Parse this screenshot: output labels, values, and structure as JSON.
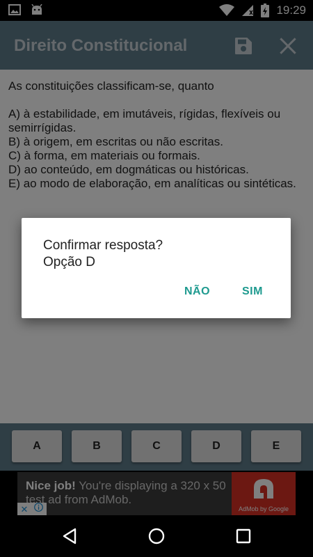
{
  "status_bar": {
    "time": "19:29",
    "icons": [
      "image-icon",
      "android-icon",
      "wifi-icon",
      "signal-icon",
      "battery-charging-icon"
    ]
  },
  "toolbar": {
    "title": "Direito Constitucional",
    "actions": [
      "save-icon",
      "close-icon"
    ]
  },
  "question": {
    "prompt": "As constituições classificam-se, quanto",
    "options": [
      "A) à estabilidade, em imutáveis, rígidas, flexíveis ou semirrígidas.",
      "B) à origem, em escritas ou não escritas.",
      "C) à forma, em materiais ou formais.",
      "D) ao conteúdo, em dogmáticas ou históricas.",
      "E) ao modo de elaboração, em analíticas ou sintéticas."
    ]
  },
  "answer_buttons": [
    "A",
    "B",
    "C",
    "D",
    "E"
  ],
  "ad": {
    "headline": "Nice job!",
    "body": "You're displaying a 320 x 50 test ad from AdMob.",
    "logo_caption": "AdMob by Google"
  },
  "dialog": {
    "line1": "Confirmar resposta?",
    "line2": "Opção D",
    "negative": "NÃO",
    "positive": "SIM"
  },
  "colors": {
    "toolbar": "#5f7c8a",
    "accent": "#1e9a8f",
    "ad_red": "#d93025"
  }
}
